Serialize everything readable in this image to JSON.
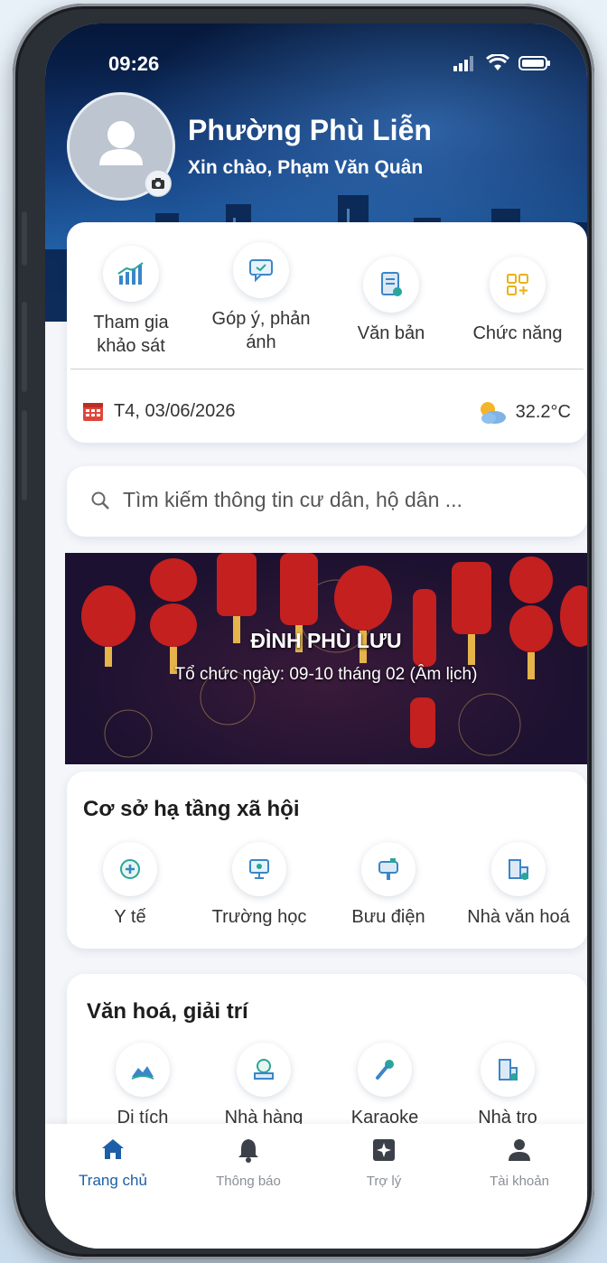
{
  "status_bar": {
    "time": "09:26"
  },
  "header": {
    "ward_name": "Phường Phù Liễn",
    "greeting": "Xin chào, Phạm Văn Quân"
  },
  "quick_actions": [
    {
      "label": "Tham gia khảo sát",
      "icon": "chart-icon"
    },
    {
      "label": "Góp ý, phản ánh",
      "icon": "feedback-icon"
    },
    {
      "label": "Văn bản",
      "icon": "document-icon"
    },
    {
      "label": "Chức năng",
      "icon": "grid-plus-icon"
    }
  ],
  "date": "T4, 03/06/2026",
  "weather": {
    "temperature": "32.2°C",
    "icon": "partly-cloudy-icon"
  },
  "search": {
    "placeholder": "Tìm kiếm thông tin cư dân, hộ dân ..."
  },
  "banner": {
    "title": "ĐÌNH PHÙ LƯU",
    "subtitle": "Tổ chức ngày: 09-10 tháng 02 (Âm lịch)"
  },
  "infrastructure": {
    "title": "Cơ sở hạ tầng xã hội",
    "items": [
      {
        "label": "Y tế",
        "icon": "medical-icon"
      },
      {
        "label": "Trường học",
        "icon": "school-icon"
      },
      {
        "label": "Bưu điện",
        "icon": "post-office-icon"
      },
      {
        "label": "Nhà văn hoá",
        "icon": "culture-house-icon"
      }
    ]
  },
  "culture": {
    "title": "Văn hoá, giải trí",
    "items": [
      {
        "label": "Di tích",
        "icon": "landscape-icon"
      },
      {
        "label": "Nhà hàng",
        "icon": "restaurant-icon"
      },
      {
        "label": "Karaoke",
        "icon": "microphone-icon"
      },
      {
        "label": "Nhà trọ",
        "icon": "building-icon"
      }
    ]
  },
  "bottom_nav": [
    {
      "label": "Trang chủ",
      "icon": "home-icon",
      "active": true
    },
    {
      "label": "Thông báo",
      "icon": "bell-icon"
    },
    {
      "label": "Trợ lý",
      "icon": "assistant-icon"
    },
    {
      "label": "Tài khoản",
      "icon": "user-icon"
    }
  ],
  "colors": {
    "accent": "#1d5fa6",
    "header_dark": "#0c2c63"
  }
}
